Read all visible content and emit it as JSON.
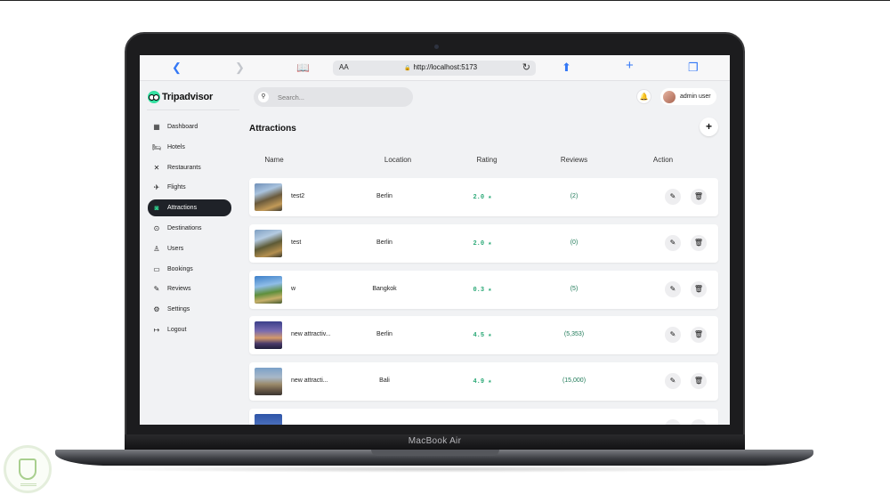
{
  "device": {
    "label": "MacBook Air"
  },
  "browser": {
    "text_size": "AA",
    "url": "http://localhost:5173",
    "icons": [
      "chevron-left-icon",
      "chevron-right-icon",
      "book-icon",
      "lock-icon",
      "reload-icon",
      "share-icon",
      "plus-icon",
      "tabs-icon"
    ]
  },
  "app": {
    "brand": "Tripadvisor",
    "accent": "#34e0a1"
  },
  "sidebar": {
    "items": [
      {
        "label": "Dashboard",
        "icon": "dashboard-icon",
        "glyph": "▦",
        "active": false
      },
      {
        "label": "Hotels",
        "icon": "bed-icon",
        "glyph": "🛏",
        "active": false
      },
      {
        "label": "Restaurants",
        "icon": "utensils-icon",
        "glyph": "✕",
        "active": false
      },
      {
        "label": "Flights",
        "icon": "plane-icon",
        "glyph": "✈",
        "active": false
      },
      {
        "label": "Attractions",
        "icon": "camera-icon",
        "glyph": "◙",
        "active": true
      },
      {
        "label": "Destinations",
        "icon": "pin-icon",
        "glyph": "⊙",
        "active": false
      },
      {
        "label": "Users",
        "icon": "user-icon",
        "glyph": "♙",
        "active": false
      },
      {
        "label": "Bookings",
        "icon": "card-icon",
        "glyph": "▭",
        "active": false
      },
      {
        "label": "Reviews",
        "icon": "review-icon",
        "glyph": "✎",
        "active": false
      },
      {
        "label": "Settings",
        "icon": "gear-icon",
        "glyph": "⚙",
        "active": false
      },
      {
        "label": "Logout",
        "icon": "logout-icon",
        "glyph": "↦",
        "active": false
      }
    ]
  },
  "header": {
    "search_placeholder": "Search...",
    "user_name": "admin user"
  },
  "main": {
    "title": "Attractions",
    "add_label": "+",
    "columns": [
      "Name",
      "Location",
      "Rating",
      "Reviews",
      "Action"
    ],
    "rows": [
      {
        "name": "test2",
        "location": "Berlin",
        "rating": "2.0 ★",
        "reviews": "(2)"
      },
      {
        "name": "test",
        "location": "Berlin",
        "rating": "2.0 ★",
        "reviews": "(0)"
      },
      {
        "name": "w",
        "location": "Bangkok",
        "rating": "0.3 ★",
        "reviews": "(5)"
      },
      {
        "name": "new attractiv...",
        "location": "Berlin",
        "rating": "4.5 ★",
        "reviews": "(5,353)"
      },
      {
        "name": "new attracti...",
        "location": "Bali",
        "rating": "4.9 ★",
        "reviews": "(15,000)"
      }
    ]
  }
}
